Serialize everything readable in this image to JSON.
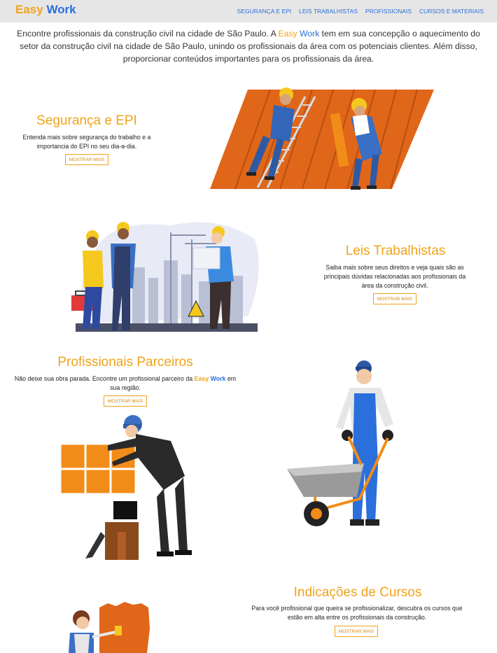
{
  "header": {
    "brand_part1": "Easy",
    "brand_part2": "Work",
    "nav": [
      "SEGURANÇA E EPI",
      "LEIS TRABALHISTAS",
      "PROFISSIONAIS",
      "CURSOS E MATERIAIS"
    ]
  },
  "intro": {
    "text_before": "Encontre profissionais da construção civil na cidade de São Paulo. A ",
    "brand_part1": "Easy",
    "brand_part2": "Work",
    "text_after": " tem em sua concepção o aquecimento do setor da construção civil na cidade de São Paulo, unindo os profissionais da área com os potenciais clientes. Além disso, proporcionar conteúdos importantes para os profissionais da área."
  },
  "sections": {
    "epi": {
      "title": "Segurança e EPI",
      "text": "Entenda mais sobre segurança do trabalho e a importancia do EPI no seu dia-a-dia.",
      "button": "MOSTRAR MAIS"
    },
    "leis": {
      "title": "Leis Trabalhistas",
      "text": "Saiba mais sobre seus direitos e veja quais são as principais dúvidas relacionadas aos profissionais da área da construção civil.",
      "button": "MOSTRAR MAIS"
    },
    "profissionais": {
      "title": "Profissionais Parceiros",
      "text_before": "Não deixe sua obra parada. Encontre um profissional parceiro da ",
      "brand_part1": "Easy",
      "brand_part2": "Work",
      "text_after": " em sua região.",
      "button": "MOSTRAR MAIS"
    },
    "cursos": {
      "title": "Indicações de Cursos",
      "text": "Para você profissional que queira se profissionalizar, descubra os cursos que estão em alta entre os profissionais da construção.",
      "button": "MOSTRAR MAIS"
    }
  },
  "colors": {
    "brand_yellow": "#f0a31a",
    "brand_blue": "#2a6fdb",
    "navbar_bg": "#e6e6e6",
    "roof_orange": "#e0661a"
  },
  "illustrations": [
    "roof-workers-illustration",
    "construction-team-illustration",
    "tiling-worker-illustration",
    "wheelbarrow-worker-illustration",
    "painter-illustration"
  ]
}
